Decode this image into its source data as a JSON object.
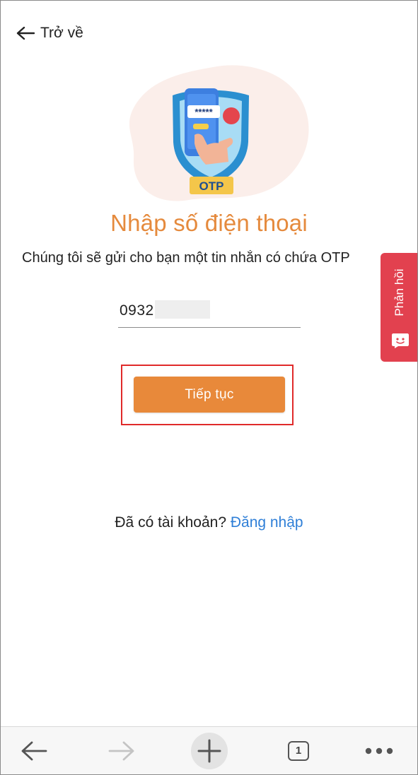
{
  "nav": {
    "back_label": "Trở về"
  },
  "illustration": {
    "badge_text": "OTP",
    "password_mask": "*****"
  },
  "page": {
    "title": "Nhập số điện thoại",
    "subtitle": "Chúng tôi sẽ gửi cho bạn một tin nhắn có chứa OTP"
  },
  "phone_input": {
    "value": "0932"
  },
  "actions": {
    "continue_label": "Tiếp tục"
  },
  "login_prompt": {
    "text": "Đã có tài khoản?",
    "link": "Đăng nhập"
  },
  "feedback_tab": {
    "label": "Phản hồi"
  },
  "browser_toolbar": {
    "tab_count": "1"
  },
  "colors": {
    "accent": "#e8893a",
    "title": "#e58a3d",
    "link": "#2f7fd7",
    "feedback": "#e2414f",
    "highlight": "#e02a2a"
  },
  "icons": [
    "arrow-left-icon",
    "otp-illustration",
    "feedback-chat-icon",
    "browser-back-icon",
    "browser-forward-icon",
    "plus-icon",
    "tabs-icon",
    "more-icon"
  ]
}
